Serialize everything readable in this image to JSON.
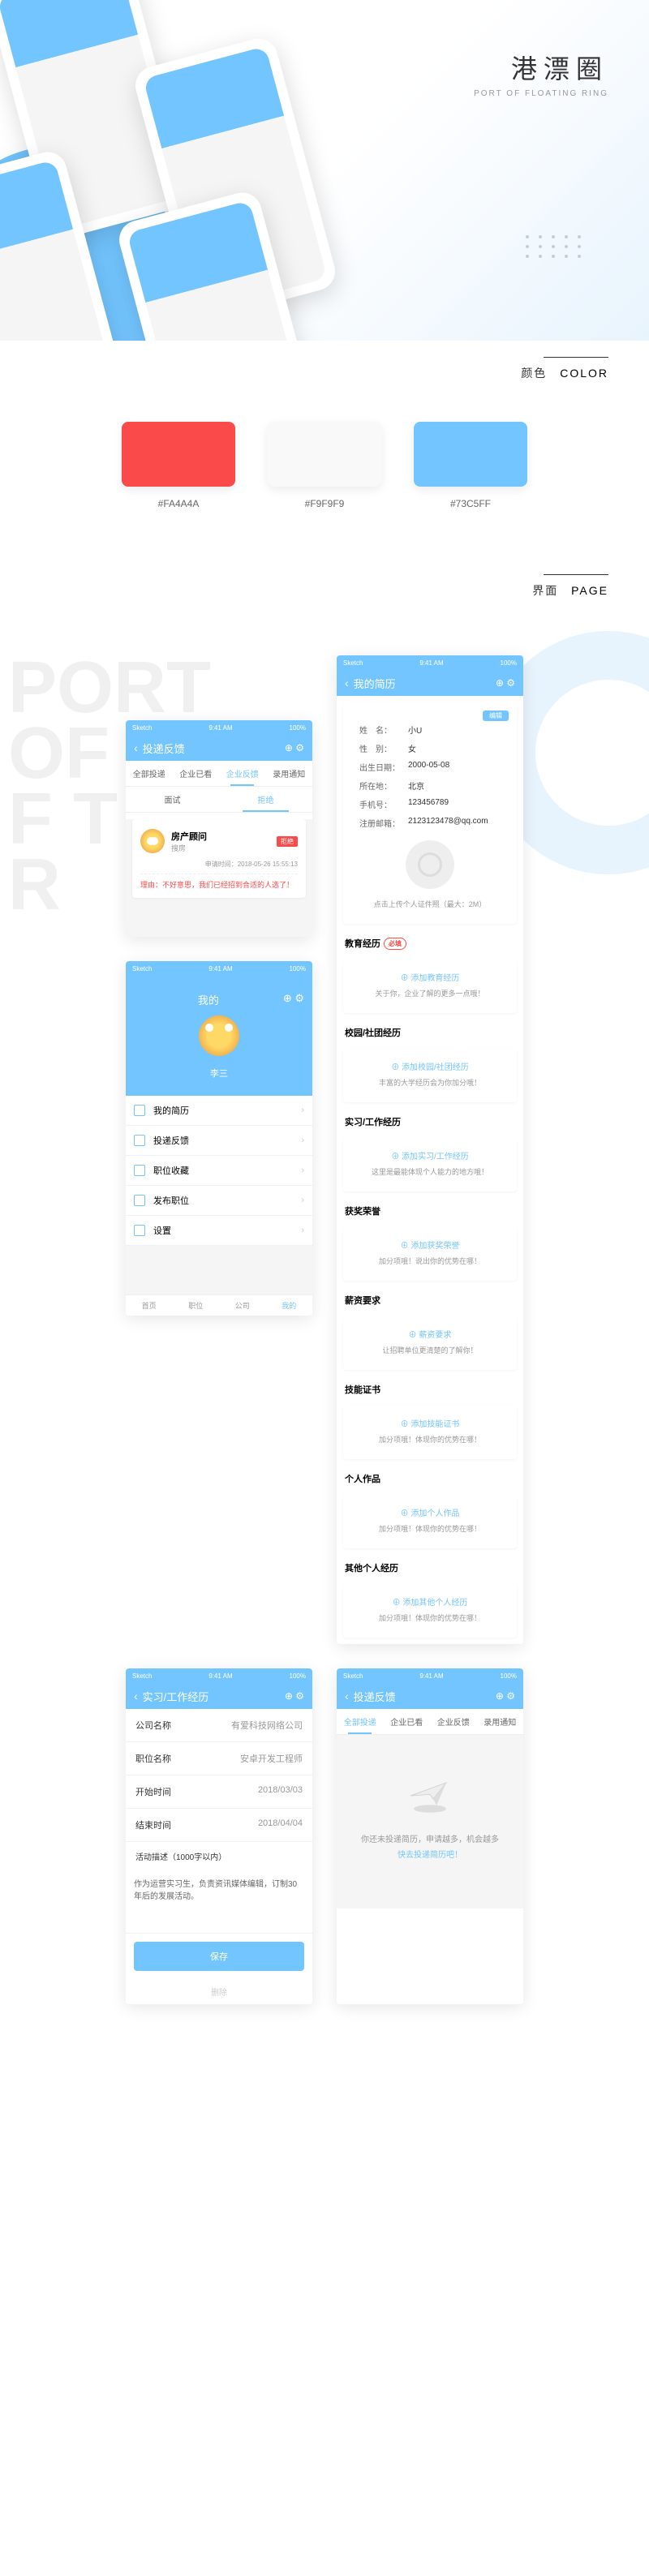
{
  "hero": {
    "title": "港漂圈",
    "subtitle": "PORT OF FLOATING RING"
  },
  "colorSection": {
    "label": "颜色",
    "labelEn": "COLOR"
  },
  "colors": [
    {
      "hex": "#FA4A4A"
    },
    {
      "hex": "#F9F9F9"
    },
    {
      "hex": "#73C5FF"
    }
  ],
  "pageSection": {
    "label": "界面",
    "labelEn": "PAGE",
    "bgText": "PORT\nOF\nFT\nR"
  },
  "statusBar": {
    "carrier": "Sketch",
    "time": "9:41 AM",
    "battery": "100%"
  },
  "feedback": {
    "navTitle": "投递反馈",
    "tabs": [
      "全部投递",
      "企业已看",
      "企业反馈",
      "录用通知"
    ],
    "activeTab": 2,
    "subtabs": [
      "面试",
      "拒绝"
    ],
    "job": {
      "title": "房产顾问",
      "company": "搜房",
      "status": "拒绝",
      "time": "申请时间：2018-05-26 15:55:13"
    },
    "rejectMsg": "理由：不好意思，我们已经招到合适的人选了！"
  },
  "resume": {
    "navTitle": "我的简历",
    "editBtn": "编辑",
    "info": {
      "name": {
        "k": "姓　名：",
        "v": "小U"
      },
      "gender": {
        "k": "性　别：",
        "v": "女"
      },
      "birth": {
        "k": "出生日期：",
        "v": "2000-05-08"
      },
      "location": {
        "k": "所在地：",
        "v": "北京"
      },
      "phone": {
        "k": "手机号：",
        "v": "123456789"
      },
      "email": {
        "k": "注册邮箱：",
        "v": "2123123478@qq.com"
      }
    },
    "photoHint": "点击上传个人证件照（最大：2M）",
    "sections": {
      "edu": {
        "title": "教育经历",
        "required": "必填",
        "add": "⊕ 添加教育经历",
        "hint": "关于你，企业了解的更多一点哦！"
      },
      "school": {
        "title": "校园/社团经历",
        "add": "⊕ 添加校园/社团经历",
        "hint": "丰富的大学经历会为你加分哦！"
      },
      "work": {
        "title": "实习/工作经历",
        "add": "⊕ 添加实习/工作经历",
        "hint": "这里是最能体现个人能力的地方哦！"
      },
      "award": {
        "title": "获奖荣誉",
        "add": "⊕ 添加获奖荣誉",
        "hint": "加分项哦！说出你的优势在哪！"
      },
      "salary": {
        "title": "薪资要求",
        "add": "⊕ 薪资要求",
        "hint": "让招聘单位更清楚的了解你！"
      },
      "cert": {
        "title": "技能证书",
        "add": "⊕ 添加技能证书",
        "hint": "加分项哦！体现你的优势在哪！"
      },
      "portfolio": {
        "title": "个人作品",
        "add": "⊕ 添加个人作品",
        "hint": "加分项哦！体现你的优势在哪！"
      },
      "other": {
        "title": "其他个人经历",
        "add": "⊕ 添加其他个人经历",
        "hint": "加分项哦！体现你的优势在哪！"
      }
    }
  },
  "mine": {
    "navTitle": "我的",
    "username": "李三",
    "menu": [
      "我的简历",
      "投递反馈",
      "职位收藏",
      "发布职位",
      "设置"
    ],
    "tabbar": [
      "首页",
      "职位",
      "公司",
      "我的"
    ]
  },
  "workForm": {
    "navTitle": "实习/工作经历",
    "fields": {
      "company": {
        "label": "公司名称",
        "value": "有爱科技网络公司"
      },
      "position": {
        "label": "职位名称",
        "value": "安卓开发工程师"
      },
      "start": {
        "label": "开始时间",
        "value": "2018/03/03"
      },
      "end": {
        "label": "结束时间",
        "value": "2018/04/04"
      }
    },
    "descLabel": "活动描述（1000字以内）",
    "descValue": "作为运营实习生，负责资讯媒体编辑，订制30年后的发展活动。",
    "saveBtn": "保存",
    "deleteBtn": "删除"
  },
  "feedbackEmpty": {
    "navTitle": "投递反馈",
    "tabs": [
      "全部投递",
      "企业已看",
      "企业反馈",
      "录用通知"
    ],
    "emptyLine1": "你还未投递简历，申请越多，机会越多",
    "emptyLine2": "快去投递简历吧！"
  }
}
